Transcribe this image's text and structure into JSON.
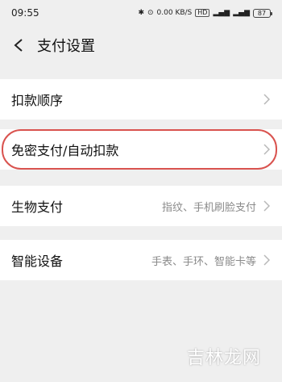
{
  "status": {
    "time": "09:55",
    "net_speed": "0.00 KB/S",
    "battery": "87"
  },
  "header": {
    "title": "支付设置"
  },
  "items": [
    {
      "label": "扣款顺序",
      "value": ""
    },
    {
      "label": "免密支付/自动扣款",
      "value": ""
    },
    {
      "label": "生物支付",
      "value": "指纹、手机刷脸支付"
    },
    {
      "label": "智能设备",
      "value": "手表、手环、智能卡等"
    }
  ],
  "watermark": "吉林龙网",
  "colors": {
    "highlight": "#d9534f",
    "background": "#efefef"
  }
}
